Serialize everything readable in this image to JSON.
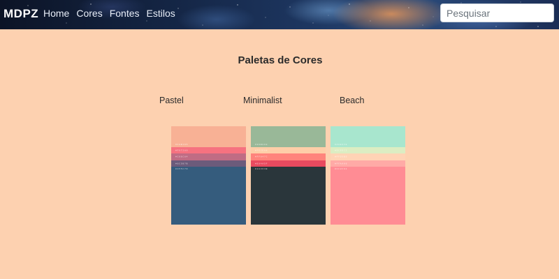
{
  "navbar": {
    "brand": "MDPZ",
    "links": [
      "Home",
      "Cores",
      "Fontes",
      "Estilos"
    ],
    "search_placeholder": "Pesquisar",
    "search_value": ""
  },
  "main": {
    "title": "Paletas de Cores",
    "palettes": [
      {
        "name": "Pastel",
        "swatches": [
          {
            "color": "#f8b195",
            "code": "#F8B195"
          },
          {
            "color": "#f67280",
            "code": "#F67280"
          },
          {
            "color": "#c06c84",
            "code": "#C06C84"
          },
          {
            "color": "#6c5b7b",
            "code": "#6C5B7B"
          },
          {
            "color": "#355c7d",
            "code": "#355C7D"
          }
        ]
      },
      {
        "name": "Minimalist",
        "swatches": [
          {
            "color": "#99b898",
            "code": "#99B898"
          },
          {
            "color": "#fecea8",
            "code": "#FECEA8"
          },
          {
            "color": "#ff847c",
            "code": "#FF847C"
          },
          {
            "color": "#e84a5f",
            "code": "#E84A5F"
          },
          {
            "color": "#2a363b",
            "code": "#2A363B"
          }
        ]
      },
      {
        "name": "Beach",
        "swatches": [
          {
            "color": "#a8e6ce",
            "code": "#A8E6CE"
          },
          {
            "color": "#dcedc2",
            "code": "#DCEDC2"
          },
          {
            "color": "#ffd3b5",
            "code": "#FFD3B5"
          },
          {
            "color": "#ffaaa6",
            "code": "#FFAAA6"
          },
          {
            "color": "#ff8c94",
            "code": "#FF8C94"
          }
        ]
      }
    ]
  }
}
